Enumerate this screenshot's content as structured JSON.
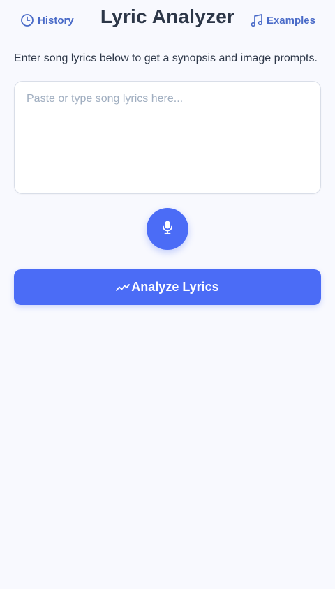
{
  "header": {
    "title": "Lyric Analyzer",
    "history_label": "History",
    "examples_label": "Examples",
    "history_icon": "clock-icon",
    "examples_icon": "music-note-icon"
  },
  "main": {
    "instructions": "Enter song lyrics below to get a synopsis and image prompts.",
    "lyrics_input": {
      "value": "",
      "placeholder": "Paste or type song lyrics here..."
    },
    "mic_icon": "microphone-icon",
    "analyze_button": {
      "label": "Analyze Lyrics",
      "icon": "trend-line-icon"
    }
  },
  "colors": {
    "background": "#f8f9fe",
    "accent": "#4b6cf6",
    "nav_link": "#4a6bc8",
    "text": "#2d3748",
    "placeholder": "#a0aec0"
  }
}
